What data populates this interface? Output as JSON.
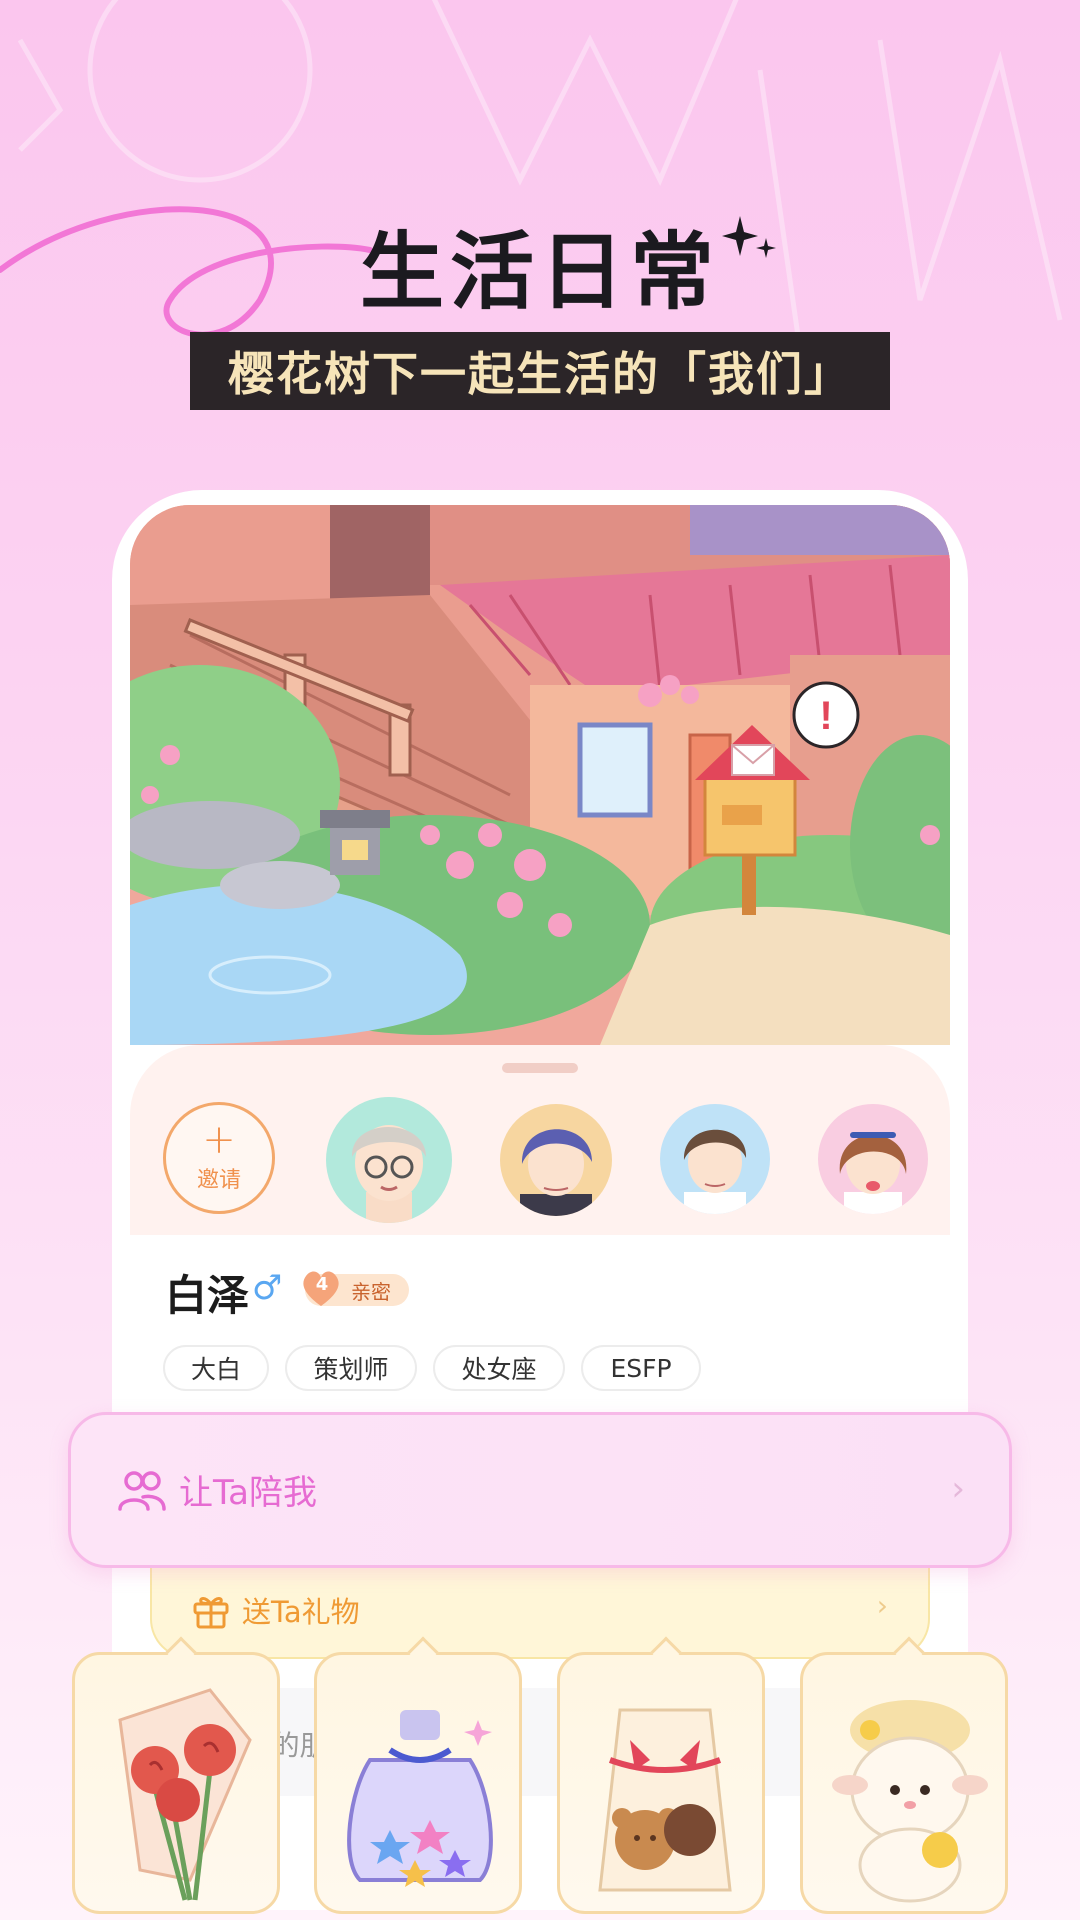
{
  "header": {
    "title": "生活日常",
    "subtitle": "樱花树下一起生活的「我们」"
  },
  "scene": {
    "notification_mark": "!"
  },
  "companions": {
    "invite_label": "邀请",
    "invite_plus": "+"
  },
  "profile": {
    "name": "白泽",
    "gender_symbol": "♂",
    "intimacy_level": "4",
    "intimacy_label": "亲密",
    "tags": [
      "大白",
      "策划师",
      "处女座",
      "ESFP"
    ]
  },
  "actions": {
    "accompany_label": "让Ta陪我",
    "gift_label": "送Ta礼物",
    "friends_label_partial": "Ta的朋友圈",
    "chevron": "›"
  },
  "colors": {
    "accent_pink": "#e66bd2",
    "accent_orange": "#ef9a34",
    "banner_dark": "#2b2528",
    "banner_text": "#f6e4b9"
  }
}
